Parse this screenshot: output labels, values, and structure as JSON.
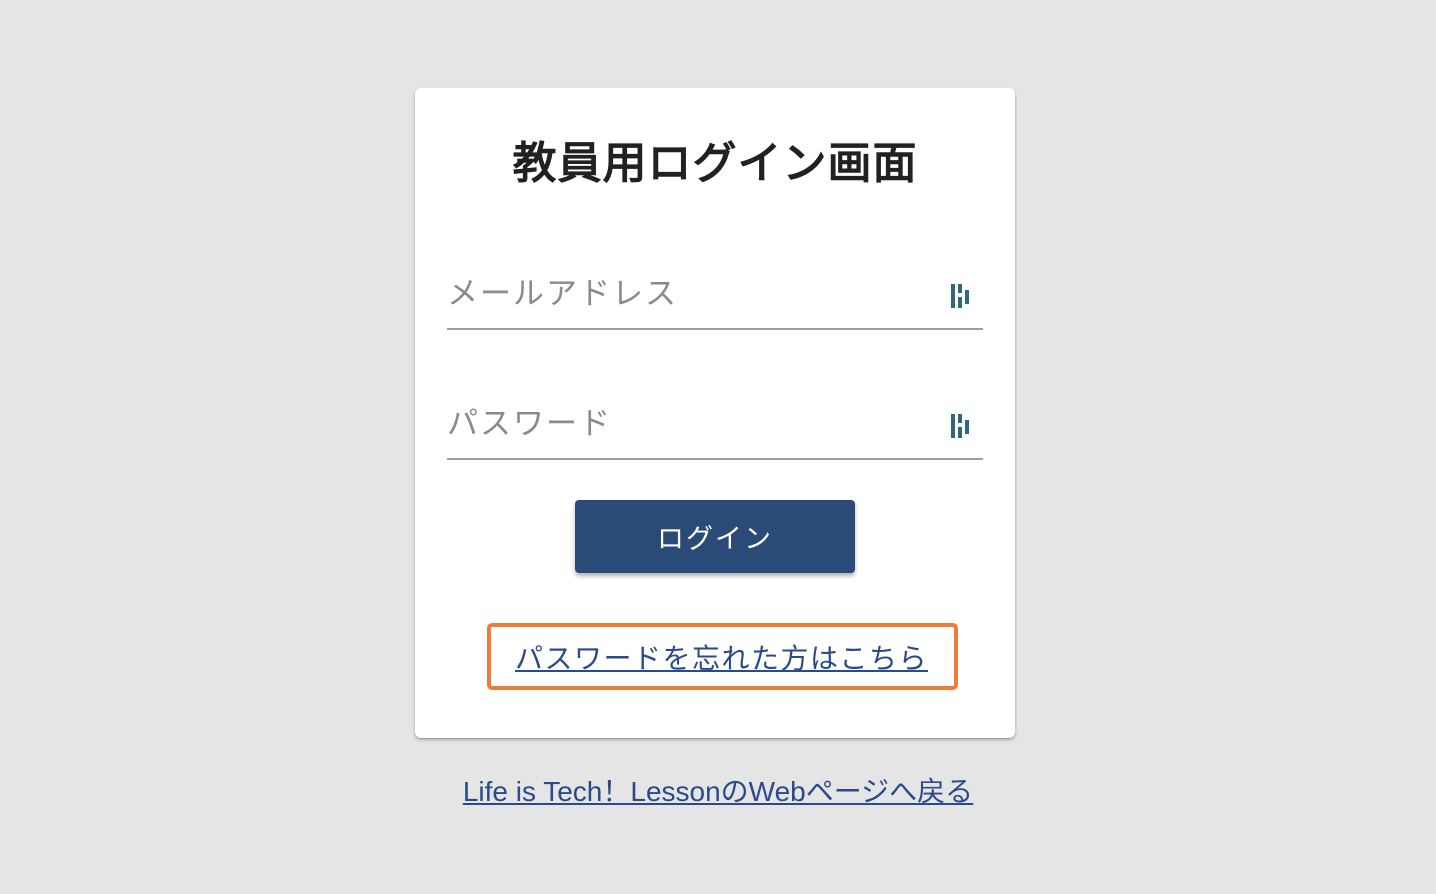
{
  "login_card": {
    "title": "教員用ログイン画面",
    "email_field": {
      "placeholder": "メールアドレス",
      "value": "",
      "icon": "password-manager-icon"
    },
    "password_field": {
      "placeholder": "パスワード",
      "value": "",
      "icon": "password-manager-icon"
    },
    "login_button_label": "ログイン",
    "forgot_password_link": "パスワードを忘れた方はこちら"
  },
  "back_link": "Life is Tech！LessonのWebページへ戻る",
  "colors": {
    "background": "#e5e5e5",
    "card": "#ffffff",
    "primary_button": "#2a4a78",
    "link": "#2a4a8a",
    "highlight_border": "#ee7d3a",
    "icon": "#2e6b7a"
  }
}
